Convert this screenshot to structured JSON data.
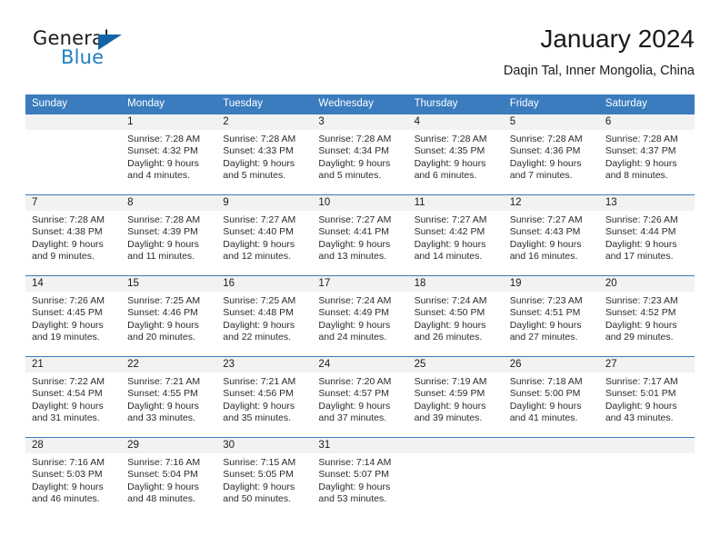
{
  "brand": {
    "name_part1": "General",
    "name_part2": "Blue",
    "triangle_color": "#1464a5",
    "blue_color": "#1f7fc4"
  },
  "header": {
    "title": "January 2024",
    "subtitle": "Daqin Tal, Inner Mongolia, China"
  },
  "theme": {
    "header_row_bg": "#3a7cbe",
    "daynum_bg": "#f2f2f2",
    "text_color": "#1a1a1a"
  },
  "weekdays": [
    "Sunday",
    "Monday",
    "Tuesday",
    "Wednesday",
    "Thursday",
    "Friday",
    "Saturday"
  ],
  "weeks": [
    [
      {
        "day": "",
        "sunrise": "",
        "sunset": "",
        "daylight1": "",
        "daylight2": ""
      },
      {
        "day": "1",
        "sunrise": "Sunrise: 7:28 AM",
        "sunset": "Sunset: 4:32 PM",
        "daylight1": "Daylight: 9 hours",
        "daylight2": "and 4 minutes."
      },
      {
        "day": "2",
        "sunrise": "Sunrise: 7:28 AM",
        "sunset": "Sunset: 4:33 PM",
        "daylight1": "Daylight: 9 hours",
        "daylight2": "and 5 minutes."
      },
      {
        "day": "3",
        "sunrise": "Sunrise: 7:28 AM",
        "sunset": "Sunset: 4:34 PM",
        "daylight1": "Daylight: 9 hours",
        "daylight2": "and 5 minutes."
      },
      {
        "day": "4",
        "sunrise": "Sunrise: 7:28 AM",
        "sunset": "Sunset: 4:35 PM",
        "daylight1": "Daylight: 9 hours",
        "daylight2": "and 6 minutes."
      },
      {
        "day": "5",
        "sunrise": "Sunrise: 7:28 AM",
        "sunset": "Sunset: 4:36 PM",
        "daylight1": "Daylight: 9 hours",
        "daylight2": "and 7 minutes."
      },
      {
        "day": "6",
        "sunrise": "Sunrise: 7:28 AM",
        "sunset": "Sunset: 4:37 PM",
        "daylight1": "Daylight: 9 hours",
        "daylight2": "and 8 minutes."
      }
    ],
    [
      {
        "day": "7",
        "sunrise": "Sunrise: 7:28 AM",
        "sunset": "Sunset: 4:38 PM",
        "daylight1": "Daylight: 9 hours",
        "daylight2": "and 9 minutes."
      },
      {
        "day": "8",
        "sunrise": "Sunrise: 7:28 AM",
        "sunset": "Sunset: 4:39 PM",
        "daylight1": "Daylight: 9 hours",
        "daylight2": "and 11 minutes."
      },
      {
        "day": "9",
        "sunrise": "Sunrise: 7:27 AM",
        "sunset": "Sunset: 4:40 PM",
        "daylight1": "Daylight: 9 hours",
        "daylight2": "and 12 minutes."
      },
      {
        "day": "10",
        "sunrise": "Sunrise: 7:27 AM",
        "sunset": "Sunset: 4:41 PM",
        "daylight1": "Daylight: 9 hours",
        "daylight2": "and 13 minutes."
      },
      {
        "day": "11",
        "sunrise": "Sunrise: 7:27 AM",
        "sunset": "Sunset: 4:42 PM",
        "daylight1": "Daylight: 9 hours",
        "daylight2": "and 14 minutes."
      },
      {
        "day": "12",
        "sunrise": "Sunrise: 7:27 AM",
        "sunset": "Sunset: 4:43 PM",
        "daylight1": "Daylight: 9 hours",
        "daylight2": "and 16 minutes."
      },
      {
        "day": "13",
        "sunrise": "Sunrise: 7:26 AM",
        "sunset": "Sunset: 4:44 PM",
        "daylight1": "Daylight: 9 hours",
        "daylight2": "and 17 minutes."
      }
    ],
    [
      {
        "day": "14",
        "sunrise": "Sunrise: 7:26 AM",
        "sunset": "Sunset: 4:45 PM",
        "daylight1": "Daylight: 9 hours",
        "daylight2": "and 19 minutes."
      },
      {
        "day": "15",
        "sunrise": "Sunrise: 7:25 AM",
        "sunset": "Sunset: 4:46 PM",
        "daylight1": "Daylight: 9 hours",
        "daylight2": "and 20 minutes."
      },
      {
        "day": "16",
        "sunrise": "Sunrise: 7:25 AM",
        "sunset": "Sunset: 4:48 PM",
        "daylight1": "Daylight: 9 hours",
        "daylight2": "and 22 minutes."
      },
      {
        "day": "17",
        "sunrise": "Sunrise: 7:24 AM",
        "sunset": "Sunset: 4:49 PM",
        "daylight1": "Daylight: 9 hours",
        "daylight2": "and 24 minutes."
      },
      {
        "day": "18",
        "sunrise": "Sunrise: 7:24 AM",
        "sunset": "Sunset: 4:50 PM",
        "daylight1": "Daylight: 9 hours",
        "daylight2": "and 26 minutes."
      },
      {
        "day": "19",
        "sunrise": "Sunrise: 7:23 AM",
        "sunset": "Sunset: 4:51 PM",
        "daylight1": "Daylight: 9 hours",
        "daylight2": "and 27 minutes."
      },
      {
        "day": "20",
        "sunrise": "Sunrise: 7:23 AM",
        "sunset": "Sunset: 4:52 PM",
        "daylight1": "Daylight: 9 hours",
        "daylight2": "and 29 minutes."
      }
    ],
    [
      {
        "day": "21",
        "sunrise": "Sunrise: 7:22 AM",
        "sunset": "Sunset: 4:54 PM",
        "daylight1": "Daylight: 9 hours",
        "daylight2": "and 31 minutes."
      },
      {
        "day": "22",
        "sunrise": "Sunrise: 7:21 AM",
        "sunset": "Sunset: 4:55 PM",
        "daylight1": "Daylight: 9 hours",
        "daylight2": "and 33 minutes."
      },
      {
        "day": "23",
        "sunrise": "Sunrise: 7:21 AM",
        "sunset": "Sunset: 4:56 PM",
        "daylight1": "Daylight: 9 hours",
        "daylight2": "and 35 minutes."
      },
      {
        "day": "24",
        "sunrise": "Sunrise: 7:20 AM",
        "sunset": "Sunset: 4:57 PM",
        "daylight1": "Daylight: 9 hours",
        "daylight2": "and 37 minutes."
      },
      {
        "day": "25",
        "sunrise": "Sunrise: 7:19 AM",
        "sunset": "Sunset: 4:59 PM",
        "daylight1": "Daylight: 9 hours",
        "daylight2": "and 39 minutes."
      },
      {
        "day": "26",
        "sunrise": "Sunrise: 7:18 AM",
        "sunset": "Sunset: 5:00 PM",
        "daylight1": "Daylight: 9 hours",
        "daylight2": "and 41 minutes."
      },
      {
        "day": "27",
        "sunrise": "Sunrise: 7:17 AM",
        "sunset": "Sunset: 5:01 PM",
        "daylight1": "Daylight: 9 hours",
        "daylight2": "and 43 minutes."
      }
    ],
    [
      {
        "day": "28",
        "sunrise": "Sunrise: 7:16 AM",
        "sunset": "Sunset: 5:03 PM",
        "daylight1": "Daylight: 9 hours",
        "daylight2": "and 46 minutes."
      },
      {
        "day": "29",
        "sunrise": "Sunrise: 7:16 AM",
        "sunset": "Sunset: 5:04 PM",
        "daylight1": "Daylight: 9 hours",
        "daylight2": "and 48 minutes."
      },
      {
        "day": "30",
        "sunrise": "Sunrise: 7:15 AM",
        "sunset": "Sunset: 5:05 PM",
        "daylight1": "Daylight: 9 hours",
        "daylight2": "and 50 minutes."
      },
      {
        "day": "31",
        "sunrise": "Sunrise: 7:14 AM",
        "sunset": "Sunset: 5:07 PM",
        "daylight1": "Daylight: 9 hours",
        "daylight2": "and 53 minutes."
      },
      {
        "day": "",
        "sunrise": "",
        "sunset": "",
        "daylight1": "",
        "daylight2": ""
      },
      {
        "day": "",
        "sunrise": "",
        "sunset": "",
        "daylight1": "",
        "daylight2": ""
      },
      {
        "day": "",
        "sunrise": "",
        "sunset": "",
        "daylight1": "",
        "daylight2": ""
      }
    ]
  ]
}
